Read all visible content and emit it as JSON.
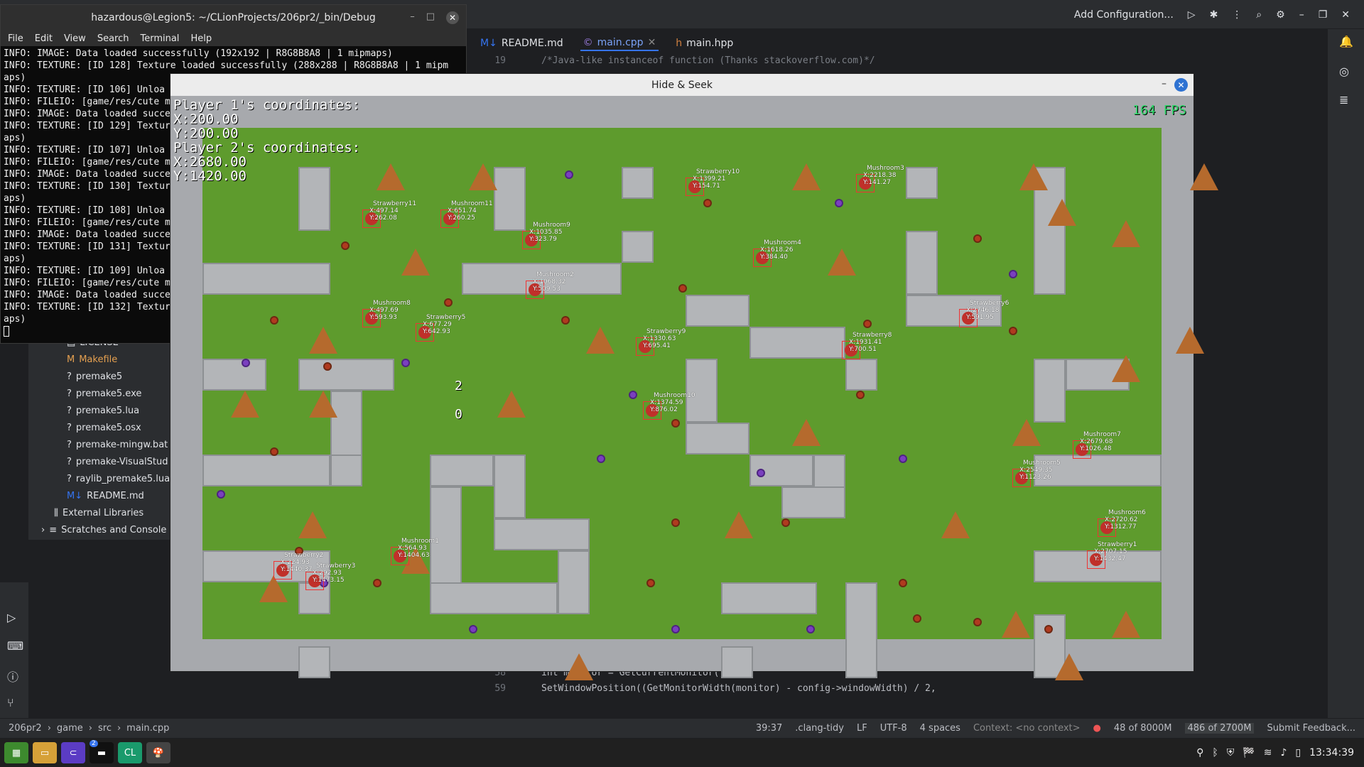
{
  "ide": {
    "run_config": "Add Configuration...",
    "tabs": [
      {
        "label": "README.md",
        "icon": "markdown-icon"
      },
      {
        "label": "main.cpp",
        "icon": "cpp-file-icon"
      },
      {
        "label": "main.hpp",
        "icon": "header-file-icon"
      }
    ],
    "code_top": {
      "line": "19",
      "text": "/*Java-like instanceof function (Thanks stackoverflow.com)*/"
    },
    "code_bottom": [
      {
        "line": "58",
        "text": "int monitor = GetCurrentMonitor();"
      },
      {
        "line": "59",
        "text": "SetWindowPosition((GetMonitorWidth(monitor) - config->windowWidth) / 2,"
      }
    ],
    "project_tree": [
      "LICENSE",
      "Makefile",
      "premake5",
      "premake5.exe",
      "premake5.lua",
      "premake5.osx",
      "premake-mingw.bat",
      "premake-VisualStud",
      "raylib_premake5.lua",
      "README.md",
      "External Libraries",
      "Scratches and Console"
    ],
    "status": {
      "breadcrumb": [
        "206pr2",
        "game",
        "src",
        "main.cpp"
      ],
      "position": "39:37",
      "linter": ".clang-tidy",
      "line_sep": "LF",
      "encoding": "UTF-8",
      "indent": "4 spaces",
      "context": "Context: <no context>",
      "memory1": "48 of 8000M",
      "memory2": "486 of 2700M",
      "feedback": "Submit Feedback..."
    }
  },
  "terminal": {
    "title": "hazardous@Legion5: ~/CLionProjects/206pr2/_bin/Debug",
    "menu": [
      "File",
      "Edit",
      "View",
      "Search",
      "Terminal",
      "Help"
    ],
    "lines": [
      "INFO: IMAGE: Data loaded successfully (192x192 | R8G8B8A8 | 1 mipmaps)",
      "INFO: TEXTURE: [ID 128] Texture loaded successfully (288x288 | R8G8B8A8 | 1 mipm",
      "aps)",
      "INFO: TEXTURE: [ID 106] Unloa",
      "INFO: FILEIO: [game/res/cute m",
      "INFO: IMAGE: Data loaded succe",
      "INFO: TEXTURE: [ID 129] Textur",
      "aps)",
      "INFO: TEXTURE: [ID 107] Unloa",
      "INFO: FILEIO: [game/res/cute m",
      "INFO: IMAGE: Data loaded succe",
      "INFO: TEXTURE: [ID 130] Textur",
      "aps)",
      "INFO: TEXTURE: [ID 108] Unloa",
      "INFO: FILEIO: [game/res/cute m",
      "INFO: IMAGE: Data loaded succe",
      "INFO: TEXTURE: [ID 131] Textur",
      "aps)",
      "INFO: TEXTURE: [ID 109] Unloa",
      "INFO: FILEIO: [game/res/cute m",
      "INFO: IMAGE: Data loaded succe",
      "INFO: TEXTURE: [ID 132] Textur",
      "aps)"
    ]
  },
  "game": {
    "title": "Hide & Seek",
    "fps": "164 FPS",
    "p1_label": "Player 1's coordinates:",
    "p1_x": "X:200.00",
    "p1_y": "Y:200.00",
    "p2_label": "Player 2's coordinates:",
    "p2_x": "X:2680.00",
    "p2_y": "Y:1420.00",
    "score_a": "2",
    "score_b": "0",
    "entities": [
      {
        "name": "Strawberry10",
        "x": "X:1399.21",
        "y": "Y:154.71"
      },
      {
        "name": "Mushroom3",
        "x": "X:2218.38",
        "y": "Y:141.27"
      },
      {
        "name": "Strawberry11",
        "x": "X:497.14",
        "y": "Y:262.08"
      },
      {
        "name": "Mushroom11",
        "x": "X:651.74",
        "y": "Y:260.25"
      },
      {
        "name": "Mushroom9",
        "x": "X:1035.85",
        "y": "Y:323.79"
      },
      {
        "name": "Mushroom4",
        "x": "X:1618.26",
        "y": "Y:384.40"
      },
      {
        "name": "Mushroom2",
        "x": "X:1068.32",
        "y": "Y:509.53"
      },
      {
        "name": "Strawberry6",
        "x": "X:2746.18",
        "y": "Y:591.95"
      },
      {
        "name": "Mushroom8",
        "x": "X:497.69",
        "y": "Y:593.93"
      },
      {
        "name": "Strawberry5",
        "x": "X:677.29",
        "y": "Y:642.93"
      },
      {
        "name": "Strawberry9",
        "x": "X:1330.63",
        "y": "Y:695.41"
      },
      {
        "name": "Strawberry8",
        "x": "X:1931.41",
        "y": "Y:700.51"
      },
      {
        "name": "Mushroom10",
        "x": "X:1374.59",
        "y": "Y:876.02"
      },
      {
        "name": "Mushroom7",
        "x": "X:2679.68",
        "y": "Y:1026.48"
      },
      {
        "name": "Mushroom5",
        "x": "X:2549.35",
        "y": "Y:1123.26"
      },
      {
        "name": "Mushroom6",
        "x": "X:2720.62",
        "y": "Y:1312.77"
      },
      {
        "name": "Mushroom1",
        "x": "X:564.93",
        "y": "Y:1404.63"
      },
      {
        "name": "Strawberry2",
        "x": "X:224.93",
        "y": "Y:1440.37"
      },
      {
        "name": "Strawberry3",
        "x": "X:292.93",
        "y": "Y:1473.15"
      },
      {
        "name": "Strawberry1",
        "x": "X:2707.15",
        "y": "Y:1432.47"
      }
    ]
  },
  "taskbar": {
    "apps": [
      "minecraft-icon",
      "files-icon",
      "vs-icon",
      "terminal-icon",
      "clion-icon",
      "mushroom-game-icon"
    ],
    "terminal_badge": "2",
    "clock": "13:34:39"
  }
}
